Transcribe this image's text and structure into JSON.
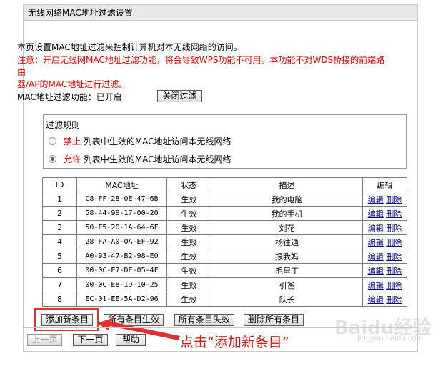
{
  "panel": {
    "title": "无线网络MAC地址过滤设置"
  },
  "intro": {
    "description": "本页设置MAC地址过滤来控制计算机对本无线网络的访问。",
    "warning_line1": "注意：开启无线网MAC地址过滤功能，将会导致WPS功能不可用。本功能不对WDS桥接的前端路由",
    "warning_line2": "器/AP的MAC地址进行过滤。"
  },
  "filter_status": {
    "label": "MAC地址过滤功能：",
    "value": "已开启",
    "toggle_button": "关闭过滤"
  },
  "rules": {
    "legend": "过滤规则",
    "options": [
      {
        "keyword": "禁止",
        "text": " 列表中生效的MAC地址访问本无线网络",
        "selected": false
      },
      {
        "keyword": "允许",
        "text": " 列表中生效的MAC地址访问本无线网络",
        "selected": true
      }
    ]
  },
  "table": {
    "headers": {
      "id": "ID",
      "mac": "MAC地址",
      "status": "状态",
      "desc": "描述",
      "edit": "编辑"
    },
    "rows": [
      {
        "id": "1",
        "mac": "C8-FF-28-0E-47-6B",
        "status": "生效",
        "desc": "我的电脑",
        "edit": "编辑",
        "delete": "删除"
      },
      {
        "id": "2",
        "mac": "58-44-98-17-00-20",
        "status": "生效",
        "desc": "我的手机",
        "edit": "编辑",
        "delete": "删除"
      },
      {
        "id": "3",
        "mac": "50-F5-20-1A-64-6F",
        "status": "生效",
        "desc": "刘花",
        "edit": "编辑",
        "delete": "删除"
      },
      {
        "id": "4",
        "mac": "28-FA-A0-0A-EF-92",
        "status": "生效",
        "desc": "杨往通",
        "edit": "编辑",
        "delete": "删除"
      },
      {
        "id": "5",
        "mac": "A0-93-47-B2-98-E0",
        "status": "生效",
        "desc": "报我妈",
        "edit": "编辑",
        "delete": "删除"
      },
      {
        "id": "6",
        "mac": "00-0C-E7-DE-05-4F",
        "status": "生效",
        "desc": "毛里丁",
        "edit": "编辑",
        "delete": "删除"
      },
      {
        "id": "7",
        "mac": "00-0C-E8-1D-10-25",
        "status": "生效",
        "desc": "引爸",
        "edit": "编辑",
        "delete": "删除"
      },
      {
        "id": "8",
        "mac": "EC-01-EE-5A-D2-96",
        "status": "生效",
        "desc": "队长",
        "edit": "编辑",
        "delete": "删除"
      }
    ]
  },
  "actions": {
    "add": "添加新条目",
    "enable_all": "所有条目生效",
    "disable_all": "所有条目失效",
    "delete_all": "删除所有条目"
  },
  "pager": {
    "prev": "上一页",
    "next": "下一页",
    "help": "帮助"
  },
  "annotation": {
    "text": "点击“添加新条目”"
  },
  "watermark": {
    "text": "Baidu经验",
    "sub": "jingyan.baidu.com"
  },
  "colors": {
    "warning": "#e00000",
    "annotation": "#d01818",
    "link": "#00008b"
  }
}
